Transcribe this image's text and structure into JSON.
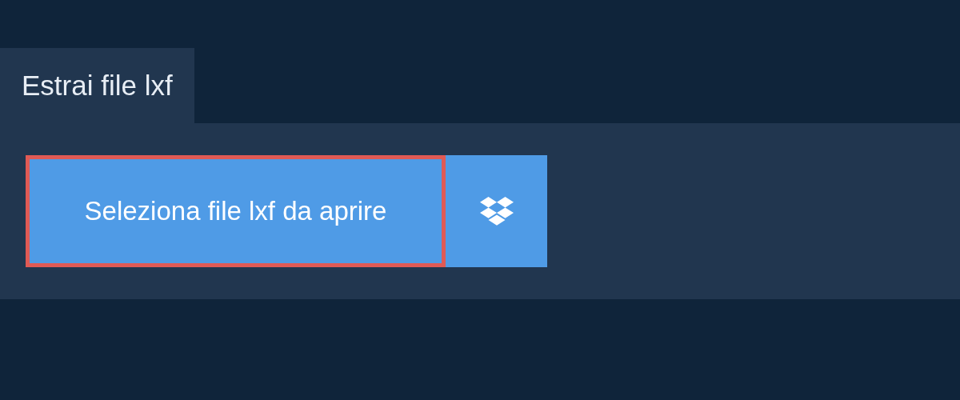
{
  "tab": {
    "label": "Estrai file lxf"
  },
  "open_button": {
    "label": "Seleziona file lxf da aprire",
    "highlighted": true
  }
}
